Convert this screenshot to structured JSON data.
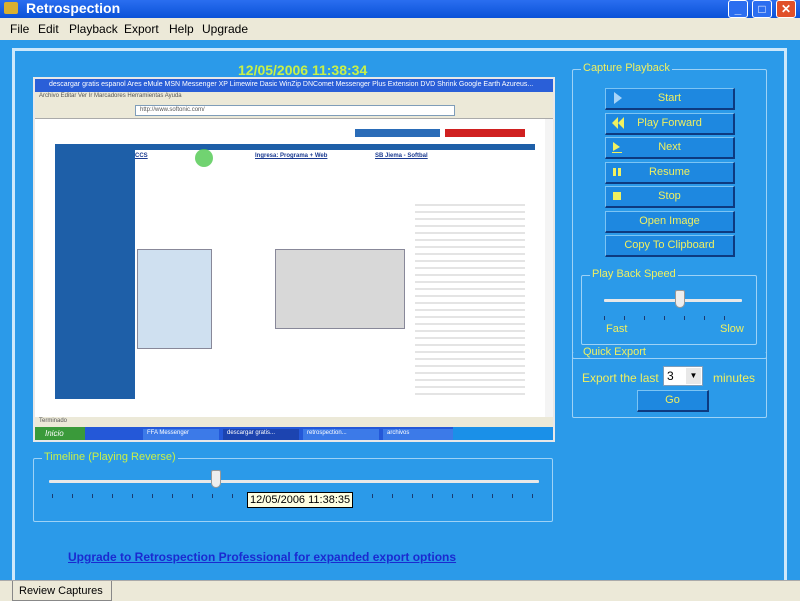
{
  "window": {
    "title": "Retrospection",
    "controls": [
      "_",
      "□",
      "✕"
    ]
  },
  "menu": [
    "File",
    "Edit",
    "Playback",
    "Export",
    "Help",
    "Upgrade"
  ],
  "capture": {
    "timestamp": "12/05/2006 11:38:34",
    "browser_title": "descargar gratis espanol Ares eMule MSN Messenger XP Limewire Dasic WinZip DNComet Messenger Plus Extension DVD Shrink Google Earth Azureus...",
    "browser_menu": "Archivo  Editar  Ver  Ir  Marcadores  Herramientas  Ayuda",
    "address": "http://www.softonic.com/",
    "sections": [
      "CCS",
      "Ingresa: Programa + Web",
      "SB Jiema - Softbal"
    ],
    "status": "Terminado",
    "taskbar": {
      "start": "Inicio",
      "items": [
        "FFA Messenger",
        "descargar gratis...",
        "retrospection...",
        "archivos"
      ]
    }
  },
  "playback": {
    "title": "Capture Playback",
    "buttons": [
      {
        "label": "Start",
        "icon": "play-icon"
      },
      {
        "label": "Play Forward",
        "icon": "rewind-icon"
      },
      {
        "label": "Next",
        "icon": "next-frame-icon"
      },
      {
        "label": "Resume",
        "icon": "pause-icon"
      },
      {
        "label": "Stop",
        "icon": "stop-icon"
      },
      {
        "label": "Open Image"
      },
      {
        "label": "Copy To Clipboard"
      }
    ],
    "speed": {
      "title": "Play Back Speed",
      "fast": "Fast",
      "slow": "Slow",
      "value": 0.55
    }
  },
  "export": {
    "title": "Quick Export",
    "prefix": "Export the last",
    "value": "3",
    "suffix": "minutes",
    "go": "Go"
  },
  "timeline": {
    "title": "Timeline (Playing Reverse)",
    "tooltip": "12/05/2006 11:38:35",
    "position": 0.34
  },
  "upgrade_link": "Upgrade to Retrospection Professional for expanded export options",
  "tabs": [
    "Review Captures"
  ],
  "colors": {
    "background": "#2b9ae9",
    "accent_text": "#f0f060",
    "timestamp": "#c8f048",
    "link": "#1a2ad0"
  }
}
